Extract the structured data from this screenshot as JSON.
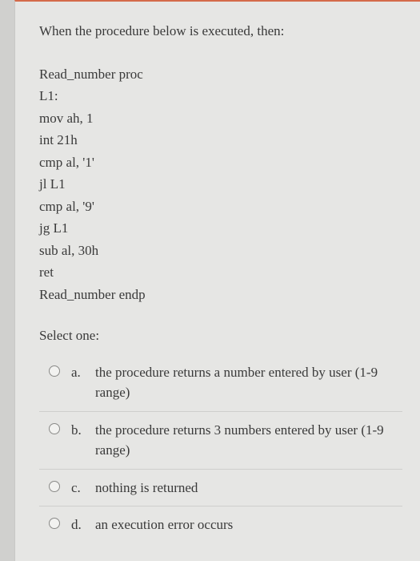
{
  "question": {
    "stem": "When the procedure below is executed, then:",
    "code_lines": [
      "Read_number proc",
      "L1:",
      "mov ah, 1",
      "int 21h",
      "cmp al, '1'",
      "jl L1",
      "cmp al, '9'",
      "jg L1",
      "sub al, 30h",
      "ret",
      "Read_number endp"
    ],
    "select_label": "Select one:",
    "options": [
      {
        "letter": "a.",
        "text": "the procedure returns a number entered by user (1-9 range)"
      },
      {
        "letter": "b.",
        "text": "the procedure returns 3 numbers entered by user (1-9 range)"
      },
      {
        "letter": "c.",
        "text": "nothing is returned"
      },
      {
        "letter": "d.",
        "text": "an execution error occurs"
      }
    ]
  }
}
